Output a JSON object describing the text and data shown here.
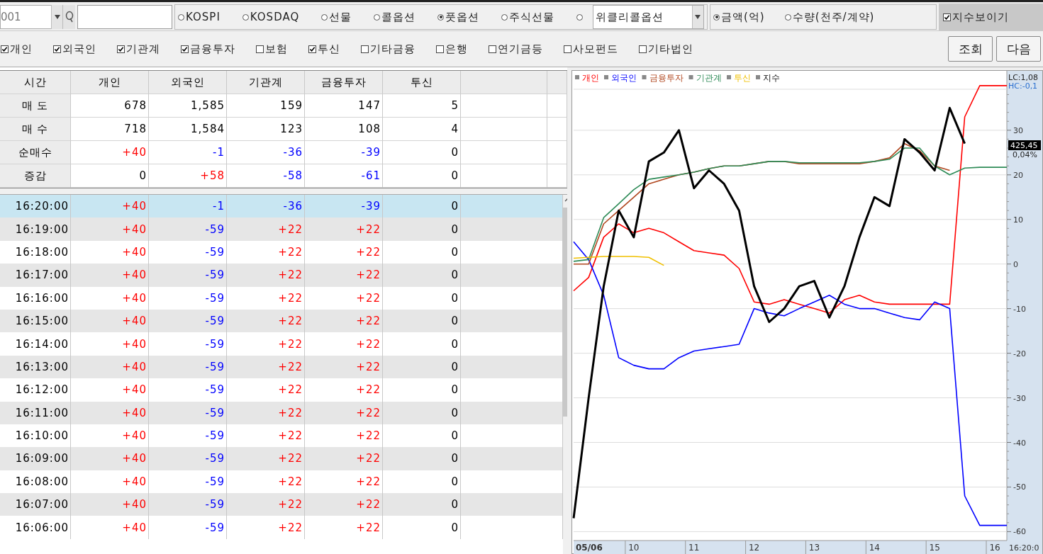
{
  "toolbar": {
    "code_field": {
      "value": "001"
    },
    "market_options": [
      {
        "kind": "radio",
        "label": "KOSPI",
        "selected": false
      },
      {
        "kind": "radio",
        "label": "KOSDAQ",
        "selected": false
      },
      {
        "kind": "radio",
        "label": "선물",
        "selected": false
      },
      {
        "kind": "radio",
        "label": "콜옵션",
        "selected": false
      },
      {
        "kind": "radio",
        "label": "풋옵션",
        "selected": true
      },
      {
        "kind": "radio",
        "label": "주식선물",
        "selected": false
      },
      {
        "kind": "combo",
        "value": "위클리콜옵션",
        "selected": false
      }
    ],
    "unit_options": [
      {
        "label": "금액(억)",
        "selected": true
      },
      {
        "label": "수량(천주/계약)",
        "selected": false
      }
    ],
    "show_index": {
      "label": "지수보이기",
      "checked": true
    }
  },
  "filters": [
    {
      "label": "개인",
      "checked": true
    },
    {
      "label": "외국인",
      "checked": true
    },
    {
      "label": "기관계",
      "checked": true
    },
    {
      "label": "금융투자",
      "checked": true
    },
    {
      "label": "보험",
      "checked": false
    },
    {
      "label": "투신",
      "checked": true
    },
    {
      "label": "기타금융",
      "checked": false
    },
    {
      "label": "은행",
      "checked": false
    },
    {
      "label": "연기금등",
      "checked": false
    },
    {
      "label": "사모펀드",
      "checked": false
    },
    {
      "label": "기타법인",
      "checked": false
    }
  ],
  "buttons": [
    "조회",
    "다음"
  ],
  "summary": {
    "columns": [
      "시간",
      "개인",
      "외국인",
      "기관계",
      "금융투자",
      "투신"
    ],
    "rows": [
      {
        "label": "매 도",
        "cells": [
          {
            "text": "678",
            "color": "#000000"
          },
          {
            "text": "1,585",
            "color": "#000000"
          },
          {
            "text": "159",
            "color": "#000000"
          },
          {
            "text": "147",
            "color": "#000000"
          },
          {
            "text": "5",
            "color": "#000000"
          }
        ]
      },
      {
        "label": "매 수",
        "cells": [
          {
            "text": "718",
            "color": "#000000"
          },
          {
            "text": "1,584",
            "color": "#000000"
          },
          {
            "text": "123",
            "color": "#000000"
          },
          {
            "text": "108",
            "color": "#000000"
          },
          {
            "text": "4",
            "color": "#000000"
          }
        ]
      },
      {
        "label": "순매수",
        "cells": [
          {
            "text": "+40",
            "color": "#ff0000"
          },
          {
            "text": "-1",
            "color": "#0000ff"
          },
          {
            "text": "-36",
            "color": "#0000ff"
          },
          {
            "text": "-39",
            "color": "#0000ff"
          },
          {
            "text": "0",
            "color": "#000000"
          }
        ]
      },
      {
        "label": "증감",
        "cells": [
          {
            "text": "0",
            "color": "#000000"
          },
          {
            "text": "+58",
            "color": "#ff0000"
          },
          {
            "text": "-58",
            "color": "#0000ff"
          },
          {
            "text": "-61",
            "color": "#0000ff"
          },
          {
            "text": "0",
            "color": "#000000"
          }
        ]
      }
    ]
  },
  "time_grid": {
    "rows": [
      {
        "time": "16:20:00",
        "selected": true,
        "cells": [
          {
            "text": "+40",
            "color": "#ff0000"
          },
          {
            "text": "-1",
            "color": "#0000ff"
          },
          {
            "text": "-36",
            "color": "#0000ff"
          },
          {
            "text": "-39",
            "color": "#0000ff"
          },
          {
            "text": "0",
            "color": "#000000"
          }
        ]
      },
      {
        "time": "16:19:00",
        "selected": false,
        "cells": [
          {
            "text": "+40",
            "color": "#ff0000"
          },
          {
            "text": "-59",
            "color": "#0000ff"
          },
          {
            "text": "+22",
            "color": "#ff0000"
          },
          {
            "text": "+22",
            "color": "#ff0000"
          },
          {
            "text": "0",
            "color": "#000000"
          }
        ]
      },
      {
        "time": "16:18:00",
        "selected": false,
        "cells": [
          {
            "text": "+40",
            "color": "#ff0000"
          },
          {
            "text": "-59",
            "color": "#0000ff"
          },
          {
            "text": "+22",
            "color": "#ff0000"
          },
          {
            "text": "+22",
            "color": "#ff0000"
          },
          {
            "text": "0",
            "color": "#000000"
          }
        ]
      },
      {
        "time": "16:17:00",
        "selected": false,
        "cells": [
          {
            "text": "+40",
            "color": "#ff0000"
          },
          {
            "text": "-59",
            "color": "#0000ff"
          },
          {
            "text": "+22",
            "color": "#ff0000"
          },
          {
            "text": "+22",
            "color": "#ff0000"
          },
          {
            "text": "0",
            "color": "#000000"
          }
        ]
      },
      {
        "time": "16:16:00",
        "selected": false,
        "cells": [
          {
            "text": "+40",
            "color": "#ff0000"
          },
          {
            "text": "-59",
            "color": "#0000ff"
          },
          {
            "text": "+22",
            "color": "#ff0000"
          },
          {
            "text": "+22",
            "color": "#ff0000"
          },
          {
            "text": "0",
            "color": "#000000"
          }
        ]
      },
      {
        "time": "16:15:00",
        "selected": false,
        "cells": [
          {
            "text": "+40",
            "color": "#ff0000"
          },
          {
            "text": "-59",
            "color": "#0000ff"
          },
          {
            "text": "+22",
            "color": "#ff0000"
          },
          {
            "text": "+22",
            "color": "#ff0000"
          },
          {
            "text": "0",
            "color": "#000000"
          }
        ]
      },
      {
        "time": "16:14:00",
        "selected": false,
        "cells": [
          {
            "text": "+40",
            "color": "#ff0000"
          },
          {
            "text": "-59",
            "color": "#0000ff"
          },
          {
            "text": "+22",
            "color": "#ff0000"
          },
          {
            "text": "+22",
            "color": "#ff0000"
          },
          {
            "text": "0",
            "color": "#000000"
          }
        ]
      },
      {
        "time": "16:13:00",
        "selected": false,
        "cells": [
          {
            "text": "+40",
            "color": "#ff0000"
          },
          {
            "text": "-59",
            "color": "#0000ff"
          },
          {
            "text": "+22",
            "color": "#ff0000"
          },
          {
            "text": "+22",
            "color": "#ff0000"
          },
          {
            "text": "0",
            "color": "#000000"
          }
        ]
      },
      {
        "time": "16:12:00",
        "selected": false,
        "cells": [
          {
            "text": "+40",
            "color": "#ff0000"
          },
          {
            "text": "-59",
            "color": "#0000ff"
          },
          {
            "text": "+22",
            "color": "#ff0000"
          },
          {
            "text": "+22",
            "color": "#ff0000"
          },
          {
            "text": "0",
            "color": "#000000"
          }
        ]
      },
      {
        "time": "16:11:00",
        "selected": false,
        "cells": [
          {
            "text": "+40",
            "color": "#ff0000"
          },
          {
            "text": "-59",
            "color": "#0000ff"
          },
          {
            "text": "+22",
            "color": "#ff0000"
          },
          {
            "text": "+22",
            "color": "#ff0000"
          },
          {
            "text": "0",
            "color": "#000000"
          }
        ]
      },
      {
        "time": "16:10:00",
        "selected": false,
        "cells": [
          {
            "text": "+40",
            "color": "#ff0000"
          },
          {
            "text": "-59",
            "color": "#0000ff"
          },
          {
            "text": "+22",
            "color": "#ff0000"
          },
          {
            "text": "+22",
            "color": "#ff0000"
          },
          {
            "text": "0",
            "color": "#000000"
          }
        ]
      },
      {
        "time": "16:09:00",
        "selected": false,
        "cells": [
          {
            "text": "+40",
            "color": "#ff0000"
          },
          {
            "text": "-59",
            "color": "#0000ff"
          },
          {
            "text": "+22",
            "color": "#ff0000"
          },
          {
            "text": "+22",
            "color": "#ff0000"
          },
          {
            "text": "0",
            "color": "#000000"
          }
        ]
      },
      {
        "time": "16:08:00",
        "selected": false,
        "cells": [
          {
            "text": "+40",
            "color": "#ff0000"
          },
          {
            "text": "-59",
            "color": "#0000ff"
          },
          {
            "text": "+22",
            "color": "#ff0000"
          },
          {
            "text": "+22",
            "color": "#ff0000"
          },
          {
            "text": "0",
            "color": "#000000"
          }
        ]
      },
      {
        "time": "16:07:00",
        "selected": false,
        "cells": [
          {
            "text": "+40",
            "color": "#ff0000"
          },
          {
            "text": "-59",
            "color": "#0000ff"
          },
          {
            "text": "+22",
            "color": "#ff0000"
          },
          {
            "text": "+22",
            "color": "#ff0000"
          },
          {
            "text": "0",
            "color": "#000000"
          }
        ]
      },
      {
        "time": "16:06:00",
        "selected": false,
        "cells": [
          {
            "text": "+40",
            "color": "#ff0000"
          },
          {
            "text": "-59",
            "color": "#0000ff"
          },
          {
            "text": "+22",
            "color": "#ff0000"
          },
          {
            "text": "+22",
            "color": "#ff0000"
          },
          {
            "text": "0",
            "color": "#000000"
          }
        ]
      }
    ]
  },
  "chart": {
    "date_label": "05/06",
    "lc_label": "LC:1,08",
    "hc_label": "HC:-0,1",
    "index_value": "425,45",
    "index_change": "0,04%",
    "time_label": "16:20:0",
    "chart_data": {
      "type": "line",
      "x": [
        9,
        9.25,
        9.5,
        9.75,
        10,
        10.25,
        10.5,
        10.75,
        11,
        11.25,
        11.5,
        11.75,
        12,
        12.25,
        12.5,
        12.75,
        13,
        13.25,
        13.5,
        13.75,
        14,
        14.25,
        14.5,
        14.75,
        15,
        15.25,
        15.5,
        15.75,
        16,
        16.2
      ],
      "xticks": [
        10,
        11,
        12,
        13,
        14,
        15,
        16
      ],
      "grid": true,
      "yticks": [
        30,
        20,
        10,
        0,
        -10,
        -20,
        -30,
        -40,
        -50,
        -60
      ],
      "ylim": [
        -62,
        43
      ],
      "xlim": [
        9,
        16.2
      ],
      "series": [
        {
          "name": "개인",
          "color": "#ff0000",
          "values": [
            -6,
            -3,
            6,
            9,
            7,
            8,
            7,
            5,
            3,
            2.5,
            2,
            -1,
            -8.5,
            -9,
            -8,
            -9,
            -10,
            -11,
            -8,
            -7,
            -8.5,
            -9,
            -9,
            -9,
            -9,
            -9,
            33,
            40,
            40,
            40
          ]
        },
        {
          "name": "외국인",
          "color": "#0000ff",
          "values": [
            5,
            1,
            -7,
            -21,
            -22.7,
            -23.5,
            -23.5,
            -21,
            -19.5,
            -19,
            -18.5,
            -18,
            -10,
            -11,
            -11.6,
            -10,
            -8.5,
            -7,
            -9,
            -10,
            -10,
            -11,
            -12,
            -12.5,
            -8.5,
            -10,
            -52,
            -58.6,
            -58.6,
            -58.6
          ]
        },
        {
          "name": "금융투자",
          "color": "#b0461e",
          "values": [
            0,
            0,
            9,
            12,
            15,
            18,
            19,
            20,
            20.6,
            21.4,
            22,
            22,
            22.5,
            23,
            23,
            22.5,
            22.5,
            22.5,
            22.5,
            22.5,
            23,
            23.8,
            27,
            25.4,
            22,
            21,
            null,
            null,
            null,
            null
          ]
        },
        {
          "name": "기관계",
          "color": "#2e8b57",
          "values": [
            0.6,
            1,
            10.4,
            13.5,
            16.7,
            19,
            19.5,
            20,
            20.6,
            21.4,
            22,
            22,
            22.5,
            23,
            23,
            22.7,
            22.7,
            22.7,
            22.7,
            22.7,
            23,
            23.5,
            26,
            26,
            22,
            20,
            21.5,
            21.7,
            21.7,
            21.7
          ]
        },
        {
          "name": "투신",
          "color": "#f0c000",
          "values": [
            1.3,
            1.5,
            1.7,
            1.7,
            1.7,
            1.5,
            -0.3,
            null,
            null,
            null,
            null,
            null,
            null,
            null,
            null,
            null,
            null,
            null,
            null,
            null,
            null,
            null,
            null,
            null,
            null,
            null,
            null,
            null,
            null,
            null
          ]
        },
        {
          "name": "지수",
          "color": "#000000",
          "values": [
            -57,
            -30,
            -5,
            12,
            6,
            23,
            25,
            30,
            17,
            21,
            18,
            12,
            -5,
            -13,
            -10,
            -5,
            -3.8,
            -12,
            -5,
            6,
            15,
            13,
            28,
            25,
            21,
            35,
            27,
            null,
            null,
            null
          ]
        }
      ]
    }
  }
}
